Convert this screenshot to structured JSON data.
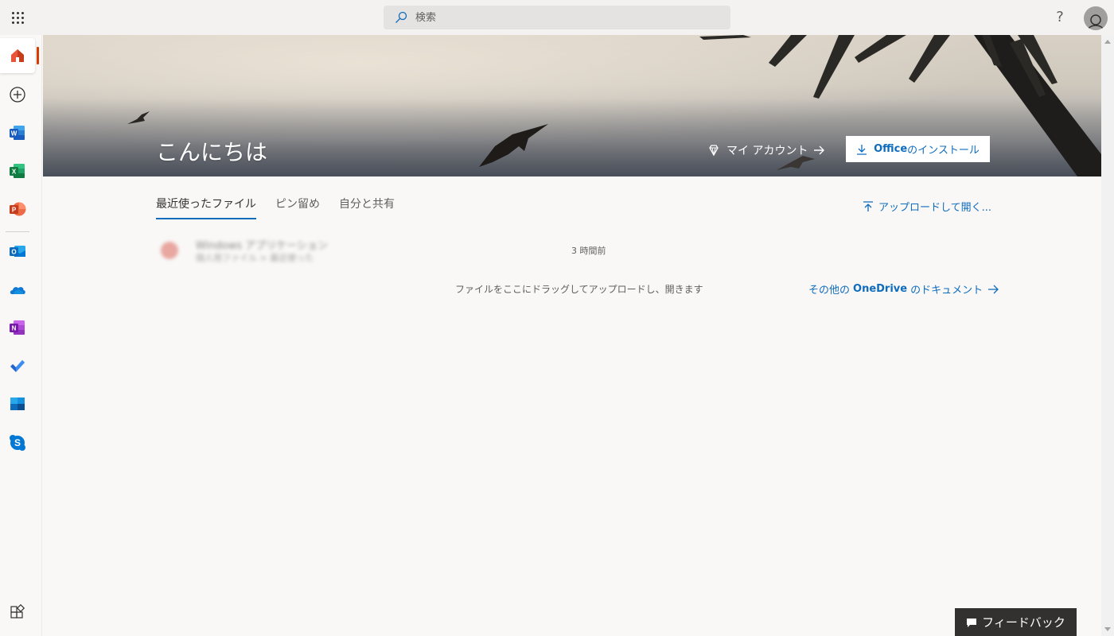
{
  "topbar": {
    "search_placeholder": "検索",
    "help_label": "?"
  },
  "rail": {
    "items": [
      {
        "name": "home",
        "icon": "home-icon",
        "active": true
      },
      {
        "name": "create",
        "icon": "plus-circle-icon"
      },
      {
        "name": "word",
        "icon": "word-icon",
        "letter": "W",
        "color": "#185abd"
      },
      {
        "name": "excel",
        "icon": "excel-icon",
        "letter": "X",
        "color": "#107c41"
      },
      {
        "name": "powerpoint",
        "icon": "powerpoint-icon",
        "letter": "P",
        "color": "#c43e1c"
      },
      {
        "name": "outlook",
        "icon": "outlook-icon",
        "letter": "O",
        "color": "#0f6cbd"
      },
      {
        "name": "onedrive",
        "icon": "onedrive-icon",
        "color": "#0f78d4"
      },
      {
        "name": "onenote",
        "icon": "onenote-icon",
        "letter": "N",
        "color": "#7719aa"
      },
      {
        "name": "todo",
        "icon": "todo-check-icon",
        "color": "#2564cf"
      },
      {
        "name": "planner",
        "icon": "tiles-icon",
        "color": "#0f6cbd"
      },
      {
        "name": "skype",
        "icon": "skype-icon",
        "letter": "S",
        "color": "#0078d4"
      }
    ],
    "bottom_icon": "all-apps-icon"
  },
  "hero": {
    "greeting": "こんにちは",
    "my_account": "マイ アカウント",
    "install_prefix": "Office",
    "install_suffix": " のインストール"
  },
  "tabs": [
    {
      "label": "最近使ったファイル",
      "active": true
    },
    {
      "label": "ピン留め"
    },
    {
      "label": "自分と共有"
    }
  ],
  "upload_link": "アップロードして開く...",
  "recent_file": {
    "name": "Windows アプリケーション",
    "path": "個人用ファイル > 最近使った",
    "time": "3 時間前"
  },
  "drag_hint": "ファイルをここにドラッグしてアップロードし、開きます",
  "onedrive_link": {
    "prefix": "その他の",
    "brand": "OneDrive",
    "suffix": "のドキュメント"
  },
  "feedback_label": "フィードバック"
}
